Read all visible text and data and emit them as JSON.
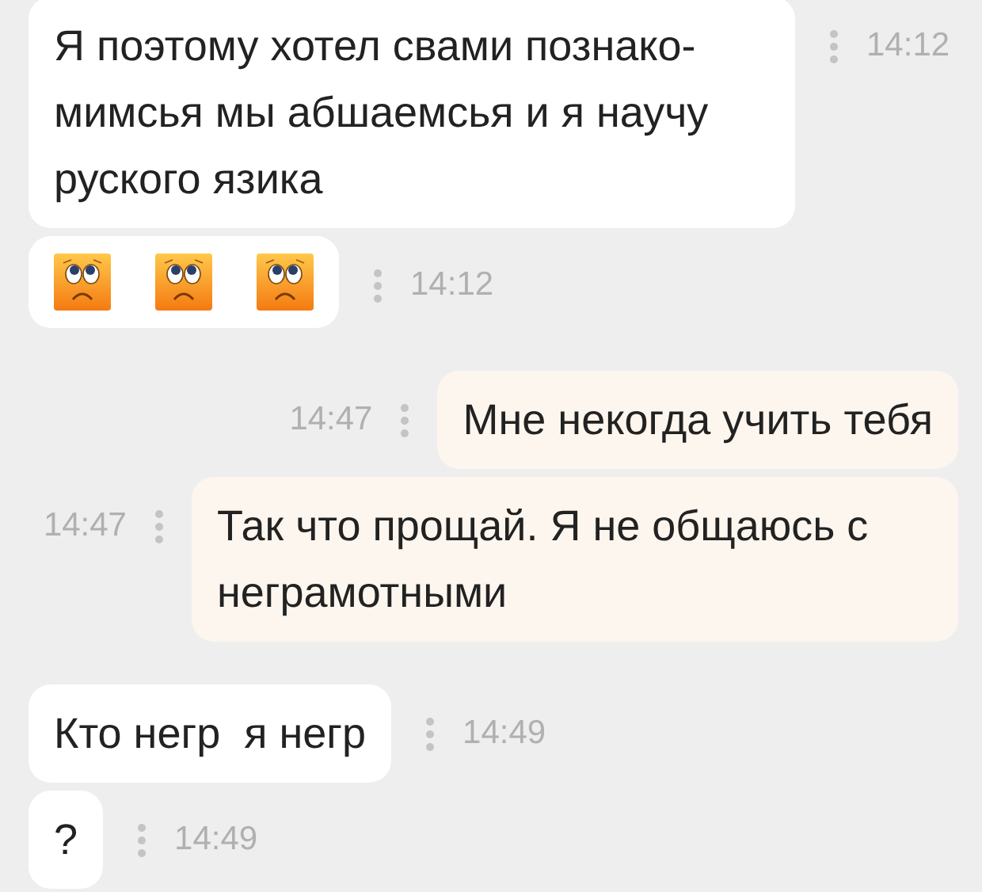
{
  "messages": [
    {
      "outgoing": false,
      "kind": "text",
      "text": "Я поэтому хотел свами познако-мимсья мы абшаемсья и я научу руского язика",
      "time": "14:12"
    },
    {
      "outgoing": false,
      "kind": "stickers",
      "stickers": [
        {
          "kind": "sad-face"
        },
        {
          "kind": "sad-face"
        },
        {
          "kind": "sad-face"
        }
      ],
      "time": "14:12"
    },
    {
      "outgoing": true,
      "kind": "text",
      "text": "Мне некогда учить тебя",
      "time": "14:47"
    },
    {
      "outgoing": true,
      "kind": "text",
      "text": "Так что прощай. Я не общаюсь с неграмотными",
      "time": "14:47"
    },
    {
      "outgoing": false,
      "kind": "text",
      "text": "Кто негр  я негр",
      "time": "14:49"
    },
    {
      "outgoing": false,
      "kind": "text",
      "text": "?",
      "time": "14:49"
    }
  ]
}
